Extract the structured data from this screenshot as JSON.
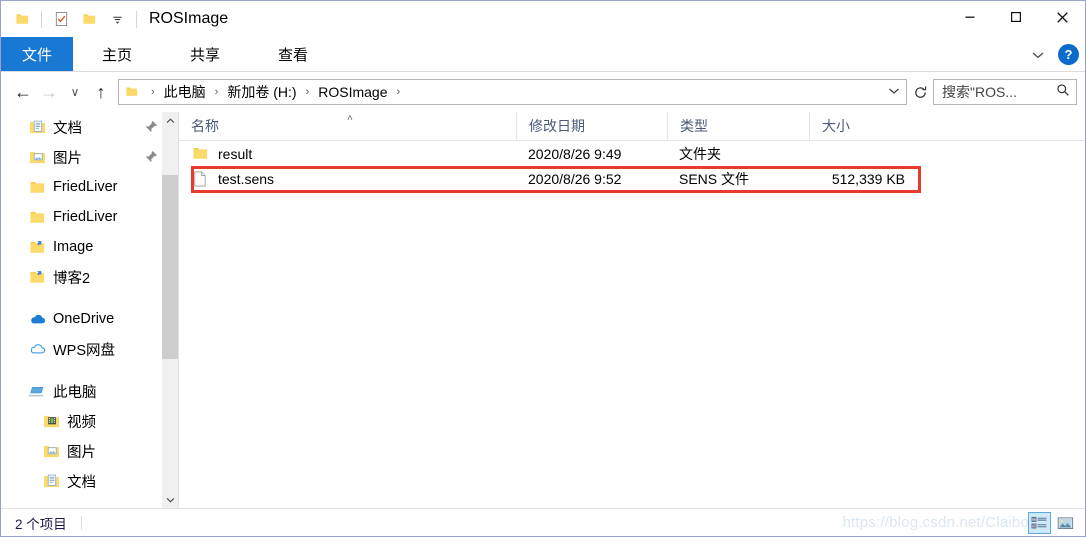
{
  "window": {
    "title": "ROSImage",
    "quick_access": [
      {
        "name": "folder-icon",
        "label": ""
      },
      {
        "name": "properties-icon",
        "label": ""
      },
      {
        "name": "new-folder-icon",
        "label": ""
      },
      {
        "name": "customize-dropdown-icon",
        "label": ""
      }
    ],
    "controls": {
      "minimize": "—",
      "maximize": "□",
      "close": "✕"
    }
  },
  "ribbon": {
    "tabs": [
      {
        "label": "文件",
        "active": true
      },
      {
        "label": "主页",
        "active": false
      },
      {
        "label": "共享",
        "active": false
      },
      {
        "label": "查看",
        "active": false
      }
    ],
    "collapse_icon": "chevron-down-icon",
    "help_label": "?"
  },
  "nav": {
    "back": "←",
    "forward": "→",
    "recent": "∨",
    "up": "↑",
    "breadcrumb": [
      "此电脑",
      "新加卷 (H:)",
      "ROSImage"
    ],
    "breadcrumb_separator": "›",
    "address_dropdown": "∨",
    "refresh": "↻"
  },
  "search": {
    "value": "搜索\"ROS...",
    "placeholder": "搜索\"ROSImage\"",
    "icon": "search-icon"
  },
  "sidebar": {
    "items": [
      {
        "label": "文档",
        "icon": "documents-folder-icon",
        "pinned": true,
        "indent": 0
      },
      {
        "label": "图片",
        "icon": "pictures-folder-icon",
        "pinned": true,
        "indent": 0
      },
      {
        "label": "FriedLiver",
        "icon": "folder-icon",
        "pinned": false,
        "indent": 0
      },
      {
        "label": "FriedLiver",
        "icon": "folder-icon",
        "pinned": false,
        "indent": 0
      },
      {
        "label": "Image",
        "icon": "shared-folder-icon",
        "pinned": false,
        "indent": 0
      },
      {
        "label": "博客2",
        "icon": "shared-folder-icon",
        "pinned": false,
        "indent": 0
      },
      {
        "label": "OneDrive",
        "icon": "onedrive-icon",
        "pinned": false,
        "indent": 0,
        "gap_before": true
      },
      {
        "label": "WPS网盘",
        "icon": "wps-cloud-icon",
        "pinned": false,
        "indent": 0
      },
      {
        "label": "此电脑",
        "icon": "this-pc-icon",
        "pinned": false,
        "indent": 0,
        "gap_before": true
      },
      {
        "label": "视频",
        "icon": "videos-folder-icon",
        "pinned": false,
        "indent": 1
      },
      {
        "label": "图片",
        "icon": "pictures-folder-icon",
        "pinned": false,
        "indent": 1
      },
      {
        "label": "文档",
        "icon": "documents-folder-icon",
        "pinned": false,
        "indent": 1
      }
    ],
    "scroll_up_icon": "chevron-up-icon",
    "scroll_down_icon": "chevron-down-icon"
  },
  "file_list": {
    "columns": [
      {
        "label": "名称",
        "sorted": true,
        "sort_dir": "asc"
      },
      {
        "label": "修改日期",
        "sorted": false
      },
      {
        "label": "类型",
        "sorted": false
      },
      {
        "label": "大小",
        "sorted": false
      }
    ],
    "sort_caret": "˄",
    "rows": [
      {
        "name": "result",
        "date": "2020/8/26 9:49",
        "type": "文件夹",
        "size": "",
        "icon": "folder-icon",
        "highlighted": false
      },
      {
        "name": "test.sens",
        "date": "2020/8/26 9:52",
        "type": "SENS 文件",
        "size": "512,339 KB",
        "icon": "generic-file-icon",
        "highlighted": true
      }
    ]
  },
  "annotation": {
    "highlight_color": "#e83b2e"
  },
  "statusbar": {
    "item_count": "2 个项目",
    "view_buttons": [
      {
        "name": "details-view-button",
        "active": true
      },
      {
        "name": "large-icons-view-button",
        "active": false
      }
    ]
  },
  "watermark": {
    "text": "https://blog.csdn.net/Claibo",
    "color": "#d9e7f2"
  }
}
